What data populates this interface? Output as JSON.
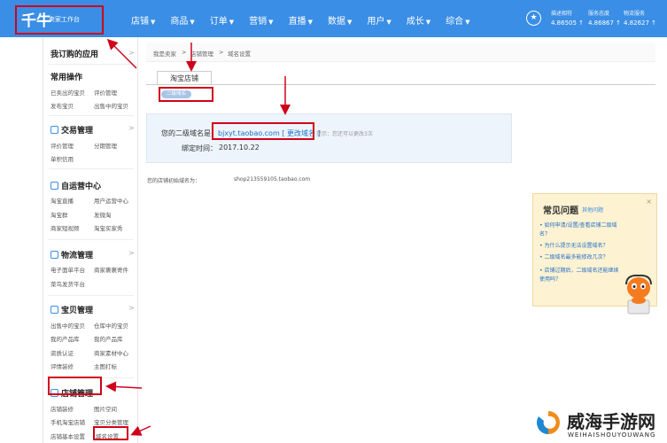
{
  "header": {
    "logo": "千牛",
    "logo_sub": "卖家工作台",
    "nav": [
      "店铺",
      "商品",
      "订单",
      "营销",
      "直播",
      "数据",
      "用户",
      "成长",
      "综合"
    ],
    "ratings": [
      {
        "title": "描述相符",
        "value": "4.86505 ↑"
      },
      {
        "title": "服务态度",
        "value": "4.86867 ↑"
      },
      {
        "title": "物流服务",
        "value": "4.82627 ↑"
      }
    ]
  },
  "sidebar": {
    "title": "我订购的应用",
    "common_title": "常用操作",
    "common_links": [
      "已卖出的宝贝",
      "评价管理",
      "发布宝贝",
      "出售中的宝贝"
    ],
    "sections": [
      {
        "title": "交易管理",
        "links": [
          "评价管理",
          "分期管理",
          "单积信用"
        ]
      },
      {
        "title": "自运营中心",
        "links": [
          "淘宝直播",
          "用户运营中心",
          "淘宝群",
          "发微淘",
          "商家短视频",
          "淘宝买家秀"
        ]
      },
      {
        "title": "物流管理",
        "links": [
          "电子面单平台",
          "商家裹裹寄件",
          "菜鸟发货平台"
        ]
      },
      {
        "title": "宝贝管理",
        "links": [
          "出售中的宝贝",
          "仓库中的宝贝",
          "我的产品库",
          "我的产品库",
          "资质认证",
          "商家素材中心",
          "评情装修",
          "主图打标"
        ]
      },
      {
        "title": "店铺管理",
        "links": [
          "店铺装修",
          "图片空间",
          "手机淘宝店铺",
          "宝贝分类管理",
          "店铺基本设置",
          "域名设置"
        ]
      }
    ]
  },
  "breadcrumb": [
    "我是卖家",
    ">",
    "店铺管理",
    ">",
    "域名设置"
  ],
  "tab": "淘宝店铺",
  "pill": "二级域名",
  "domain": {
    "label": "您的二级域名是：",
    "value": "bjxyt.taobao.com [ 更改域名 ]",
    "hint": "提示：您还可以更改3次",
    "bind_label": "绑定时间：",
    "bind_value": "2017.10.22",
    "init_label": "您的店铺初始域名为：",
    "init_value": "shop213559105.taobao.com"
  },
  "faq": {
    "title": "常见问题",
    "sub": "其他问题",
    "close": "×",
    "questions": [
      "如何申请/设置/查看店铺二级域名？",
      "为什么提示无法设置域名？",
      "二级域名最多能修改几次？",
      "店铺过期后，二级域名还能继续使用吗？"
    ]
  },
  "watermark": {
    "title": "威海手游网",
    "sub": "WEIHAISHOUYOUWANG"
  },
  "colors": {
    "accent": "#3a8ee6",
    "annotation": "#d0021b",
    "faq_bg": "#fdf2d2",
    "panel_bg": "#eef4fb"
  }
}
